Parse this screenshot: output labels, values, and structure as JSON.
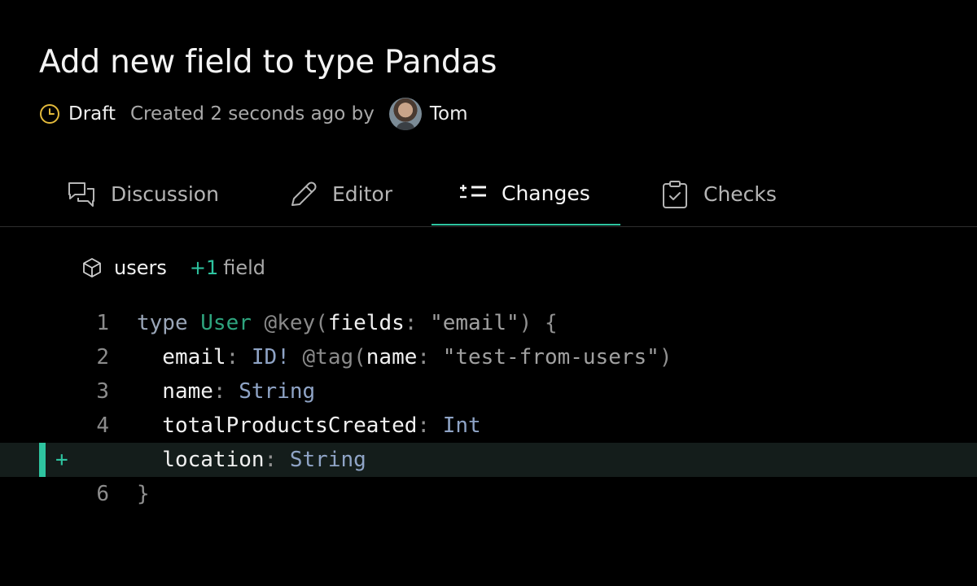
{
  "page": {
    "title": "Add new field to type Pandas",
    "status": "Draft",
    "created_text": "Created 2 seconds ago by",
    "author": "Tom"
  },
  "tabs": [
    {
      "label": "Discussion",
      "icon": "chat-bubbles-icon",
      "active": false
    },
    {
      "label": "Editor",
      "icon": "pencil-icon",
      "active": false
    },
    {
      "label": "Changes",
      "icon": "diff-list-icon",
      "active": true
    },
    {
      "label": "Checks",
      "icon": "clipboard-check-icon",
      "active": false
    }
  ],
  "diff": {
    "file": "users",
    "change_count": "+1",
    "change_suffix": "field",
    "lines": [
      {
        "number": "1",
        "added": false,
        "tokens": [
          {
            "t": "type ",
            "c": "kw"
          },
          {
            "t": "User",
            "c": "typ"
          },
          {
            "t": " @key(",
            "c": "dir"
          },
          {
            "t": "fields",
            "c": ""
          },
          {
            "t": ": ",
            "c": "punc"
          },
          {
            "t": "\"email\"",
            "c": "str"
          },
          {
            "t": ") {",
            "c": "punc"
          }
        ]
      },
      {
        "number": "2",
        "added": false,
        "tokens": [
          {
            "t": "  email",
            "c": ""
          },
          {
            "t": ": ",
            "c": "punc"
          },
          {
            "t": "ID!",
            "c": "scalar"
          },
          {
            "t": " @tag(",
            "c": "dir"
          },
          {
            "t": "name",
            "c": ""
          },
          {
            "t": ": ",
            "c": "punc"
          },
          {
            "t": "\"test-from-users\"",
            "c": "str"
          },
          {
            "t": ")",
            "c": "punc"
          }
        ]
      },
      {
        "number": "3",
        "added": false,
        "tokens": [
          {
            "t": "  name",
            "c": ""
          },
          {
            "t": ": ",
            "c": "punc"
          },
          {
            "t": "String",
            "c": "scalar"
          }
        ]
      },
      {
        "number": "4",
        "added": false,
        "tokens": [
          {
            "t": "  totalProductsCreated",
            "c": ""
          },
          {
            "t": ": ",
            "c": "punc"
          },
          {
            "t": "Int",
            "c": "scalar"
          }
        ]
      },
      {
        "number": "+",
        "added": true,
        "tokens": [
          {
            "t": "  location",
            "c": ""
          },
          {
            "t": ": ",
            "c": "punc"
          },
          {
            "t": "String",
            "c": "scalar"
          }
        ]
      },
      {
        "number": "6",
        "added": false,
        "tokens": [
          {
            "t": "}",
            "c": "punc"
          }
        ]
      }
    ]
  },
  "colors": {
    "accent": "#2ec4a0",
    "draft_clock": "#e2b93b",
    "background": "#000000"
  }
}
